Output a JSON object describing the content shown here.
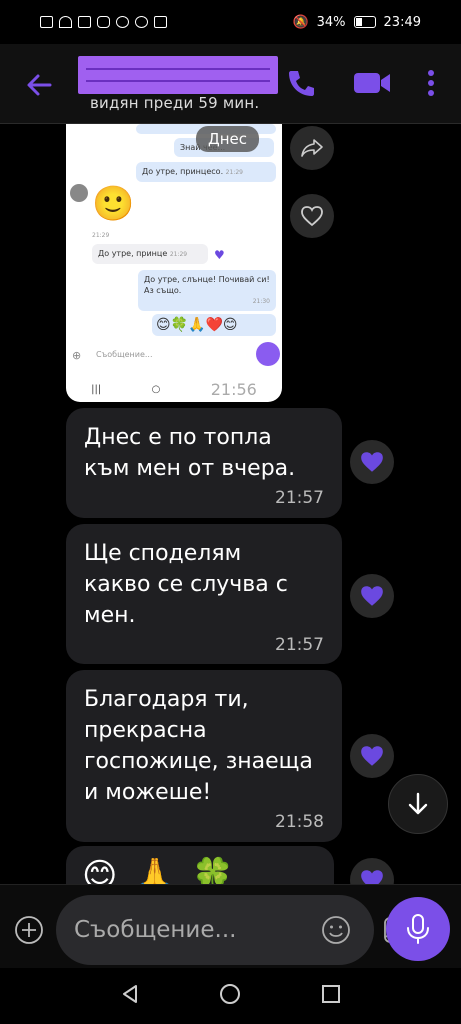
{
  "status_bar": {
    "battery": "34%",
    "time": "23:49"
  },
  "header": {
    "last_seen": "видян преди 59 мин."
  },
  "screenshot": {
    "date_chip": "Днес",
    "bubble_top1": "Знай чее...",
    "bubble_top2": "До утре, принцесо.",
    "bubble_top2_time": "21:29",
    "time_left": "21:29",
    "left_bubble": "До утре, принце",
    "left_bubble_time": "21:29",
    "right_bubble": "До утре, слънце! Почивай си! Аз също.",
    "right_bubble_time": "21:30",
    "emoji_row": "😊🍀🙏❤️😊",
    "input_placeholder": "Съобщение...",
    "overlay_time": "21:56"
  },
  "messages": [
    {
      "text": "Днес е по топла\nкъм мен от вчера.",
      "time": "21:57"
    },
    {
      "text": "Ще споделям\nкакво се случва с\nмен.",
      "time": "21:57"
    },
    {
      "text": "Благодаря ти,\nпрекрасна\nгоспожице, знаеща\nи можеше!",
      "time": "21:58"
    }
  ],
  "emoji_message": "😊🙏🍀",
  "composer": {
    "placeholder": "Съобщение..."
  },
  "colors": {
    "accent": "#7b4fe8",
    "bubble": "#1f1f22",
    "heart": "#6b49e0"
  }
}
